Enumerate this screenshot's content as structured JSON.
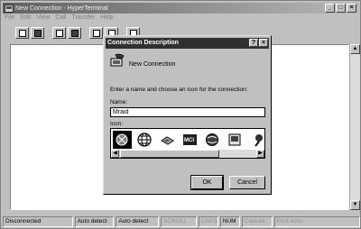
{
  "window": {
    "title": "New Connection - HyperTerminal",
    "buttons": {
      "minimize": "_",
      "maximize": "□",
      "close": "×"
    }
  },
  "menu": [
    "File",
    "Edit",
    "View",
    "Call",
    "Transfer",
    "Help"
  ],
  "toolbar": [
    "new-icon",
    "open-icon",
    "disconnect-icon",
    "properties-icon",
    "send-icon",
    "receive-icon",
    "print-icon"
  ],
  "statusbar": [
    "Disconnected",
    "Auto detect",
    "Auto detect",
    "SCROLL",
    "CAPS",
    "NUM",
    "Capture",
    "Print echo"
  ],
  "dialog": {
    "title": "Connection Description",
    "help_btn": "?",
    "close_btn": "×",
    "connection_label": "New Connection",
    "instruction": "Enter a name and choose an icon for the connection:",
    "name_label": "Name:",
    "name_value": "Mraid",
    "icon_label": "Icon:",
    "icons": [
      "phone-icon",
      "globe-icon",
      "computer-icon",
      "mci-icon",
      "globe-phone-icon",
      "envelope-icon",
      "handset-icon"
    ],
    "ok": "OK",
    "cancel": "Cancel"
  },
  "colors": {
    "face": "#c0c0c0",
    "title_active": "#303030",
    "title_inactive": "#909090"
  }
}
